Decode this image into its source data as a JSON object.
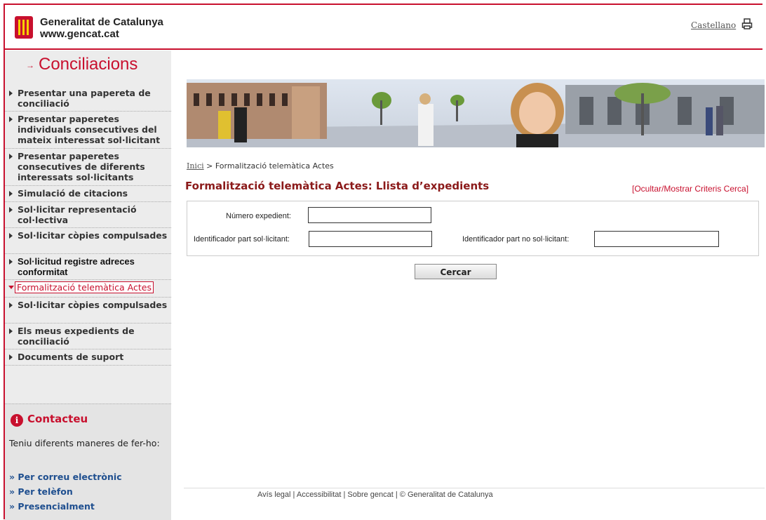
{
  "header": {
    "brand_name": "Generalitat de Catalunya",
    "brand_url": "www.gencat.cat",
    "language_link": "Castellano",
    "print_icon": "printer-icon"
  },
  "sidebar": {
    "app_title": "Conciliacions",
    "app_title_arrow": "→",
    "menu": [
      {
        "label": "Presentar una papereta de conciliació"
      },
      {
        "label": "Presentar paperetes individuals consecutives del mateix interessat sol·licitant"
      },
      {
        "label": "Presentar paperetes consecutives de diferents interessats sol·licitants"
      },
      {
        "label": "Simulació de citacions"
      },
      {
        "label": "Sol·licitar representació col·lectiva"
      },
      {
        "label": "Sol·licitar còpies compulsades"
      },
      {
        "label": "Sol·licitud registre adreces conformitat"
      },
      {
        "label": "Formalització telemàtica Actes",
        "active": true
      },
      {
        "label": "Sol·licitar còpies compulsades"
      },
      {
        "label": "Els meus expedients de conciliació"
      },
      {
        "label": "Documents de suport"
      }
    ],
    "contact": {
      "title": "Contacteu",
      "icon": "info-icon",
      "text": "Teniu diferents maneres de fer-ho:",
      "links": [
        "» Per correu electrònic",
        "» Per telèfon",
        "» Presencialment"
      ]
    }
  },
  "main": {
    "breadcrumb_home": "Inici",
    "breadcrumb_sep": " > ",
    "breadcrumb_current": "Formalització telemàtica Actes",
    "title": "Formalització telemàtica Actes: Llista d’expedients",
    "toggle_criteria": "[Ocultar/Mostrar Criteris Cerca]",
    "form": {
      "expedient_label": "Número expedient:",
      "expedient_value": "",
      "applicant_label": "Identificador part sol·licitant:",
      "applicant_value": "",
      "non_applicant_label": "Identificador part no sol·licitant:",
      "non_applicant_value": ""
    },
    "search_button": "Cercar"
  },
  "footer": {
    "text": "Avís legal | Accessibilitat | Sobre gencat | © Generalitat de Catalunya"
  },
  "colors": {
    "brand_red": "#c8102e",
    "title_dark_red": "#8b1a1a",
    "link_blue": "#1f4f8f",
    "sidebar_bg": "#ececec"
  }
}
